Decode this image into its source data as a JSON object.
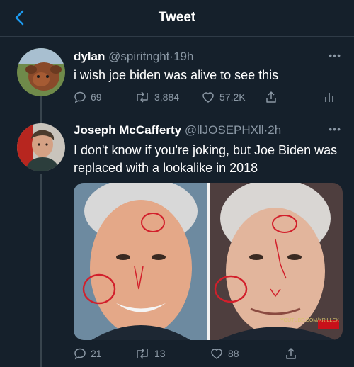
{
  "header": {
    "title": "Tweet"
  },
  "tweet1": {
    "name": "dylan",
    "handle": "@spiritnght",
    "time": "19h",
    "text": "i wish joe biden was alive to see this",
    "replies": "69",
    "retweets": "3,884",
    "likes": "57.2K"
  },
  "tweet2": {
    "name": "Joseph McCafferty",
    "handle": "@llJOSEPHXll",
    "time": "2h",
    "text": "I don't know if you're joking, but Joe Biden was replaced with a lookalike in 2018",
    "media_caption": "YOUTUBE.COM/KRILLEX",
    "replies": "21",
    "retweets": "13",
    "likes": "88"
  },
  "colors": {
    "background": "#15202b",
    "text": "#e7e9ea",
    "secondary": "#8b98a5",
    "accent": "#1d9bf0"
  }
}
